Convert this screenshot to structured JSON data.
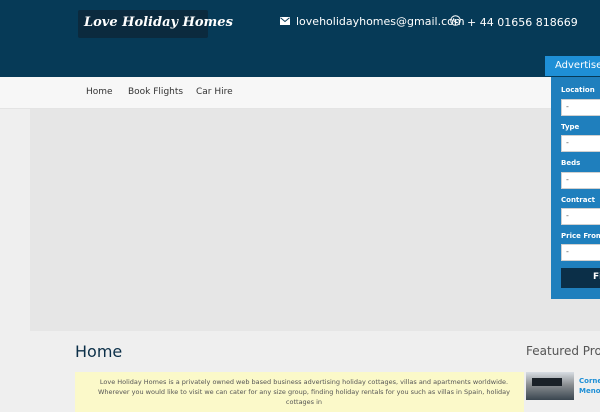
{
  "header": {
    "logo_text": "Love Holiday Homes",
    "email": "loveholidayhomes@gmail.com",
    "phone": "+ 44 01656 818669"
  },
  "nav": {
    "items": [
      {
        "label": "Home"
      },
      {
        "label": "Book Flights"
      },
      {
        "label": "Car Hire"
      }
    ]
  },
  "search": {
    "tab_label": "Advertise",
    "fields": [
      {
        "label": "Location",
        "value": "-"
      },
      {
        "label": "Type",
        "value": "-"
      },
      {
        "label": "Beds",
        "value": "-"
      },
      {
        "label": "Contract",
        "value": "-"
      },
      {
        "label": "Price From",
        "value": "-"
      }
    ],
    "button_label": "Fi"
  },
  "main": {
    "title": "Home",
    "intro": "Love Holiday Homes is a privately owned web based business advertising holiday cottages, villas and apartments worldwide. Wherever you would like to visit we can cater for any size group, finding holiday rentals for you such as villas in Spain, holiday cottages in"
  },
  "featured": {
    "title": "Featured Pro",
    "item_title": "Corne Meno"
  },
  "colors": {
    "header_bg": "#063a57",
    "accent": "#1e8fd6",
    "panel_bg": "#1f7fbd",
    "intro_bg": "#fbf9c9"
  }
}
